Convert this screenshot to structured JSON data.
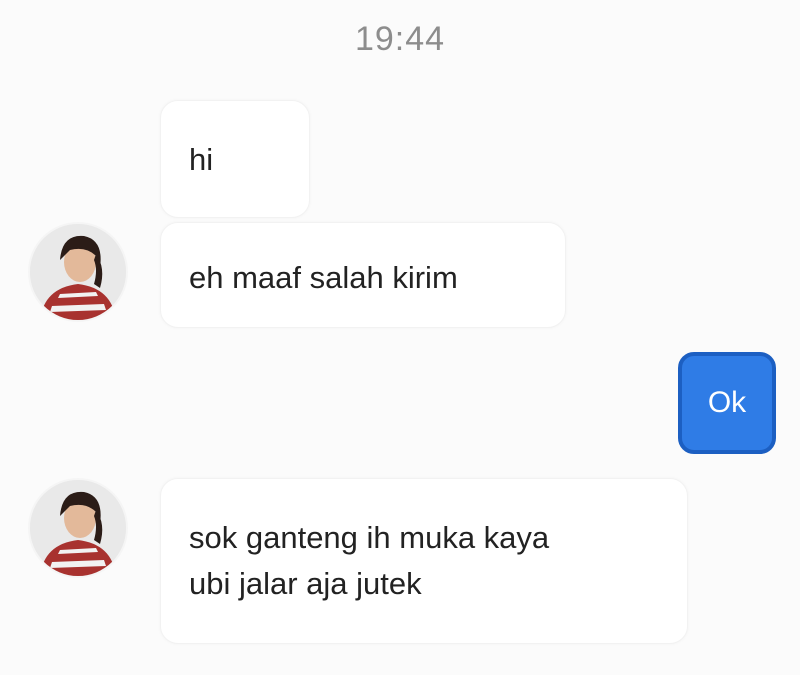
{
  "conversation": {
    "timestamp": "19:44",
    "messages": [
      {
        "direction": "incoming",
        "text": "hi",
        "avatar": false
      },
      {
        "direction": "incoming",
        "text": "eh maaf salah kirim",
        "avatar": true
      },
      {
        "direction": "outgoing",
        "text": "Ok"
      },
      {
        "direction": "incoming",
        "text": "sok ganteng ih muka kaya\nubi jalar aja jutek",
        "avatar": true
      }
    ]
  },
  "colors": {
    "outgoing_bubble": "#2f7ce6",
    "outgoing_border": "#1c5fc2",
    "incoming_bubble": "#ffffff",
    "timestamp_text": "#8d8d8d"
  }
}
